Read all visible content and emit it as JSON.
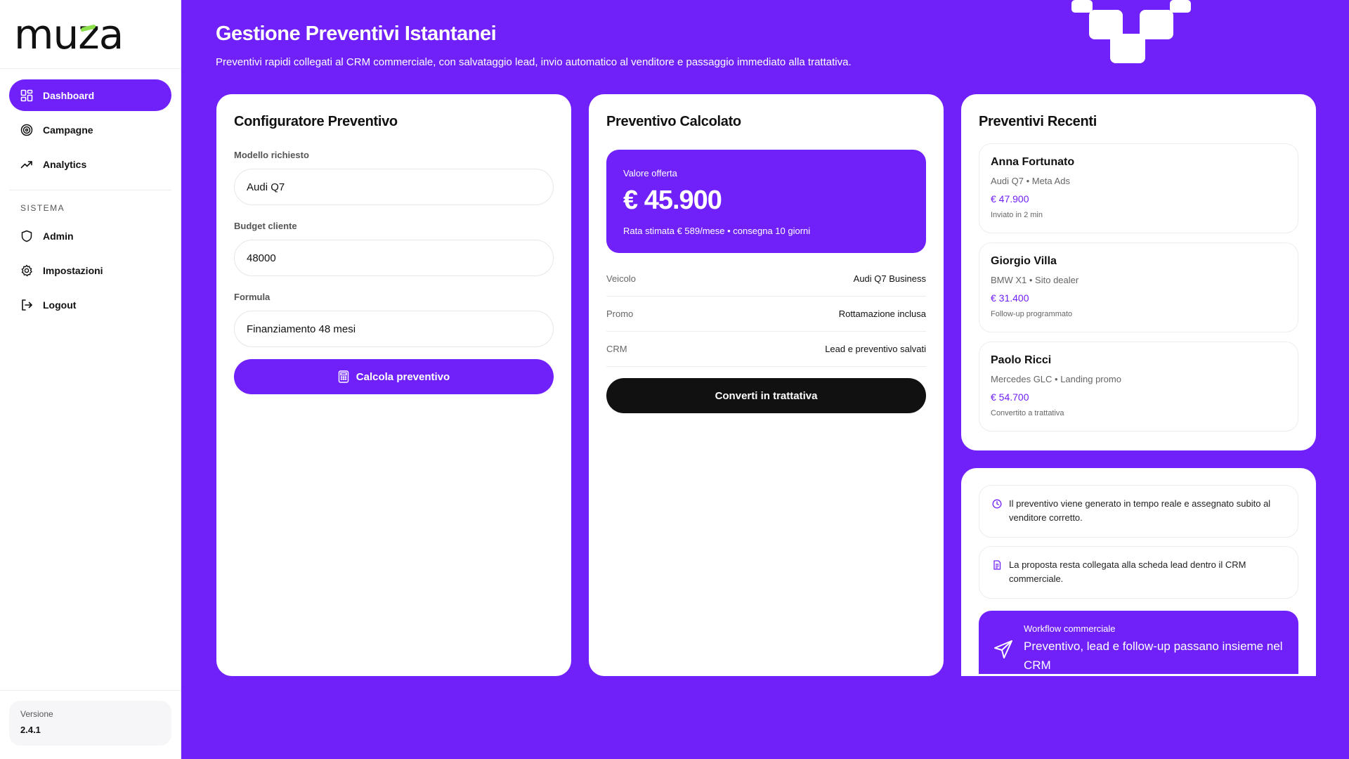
{
  "brand": {
    "logo_text_left": "mu",
    "logo_text_z": "z",
    "logo_text_right": "a"
  },
  "sidebar": {
    "items": [
      {
        "label": "Dashboard",
        "icon": "dashboard-icon",
        "active": true
      },
      {
        "label": "Campagne",
        "icon": "target-icon"
      },
      {
        "label": "Analytics",
        "icon": "trend-up-icon"
      }
    ],
    "section_label": "SISTEMA",
    "system_items": [
      {
        "label": "Admin",
        "icon": "shield-icon"
      },
      {
        "label": "Impostazioni",
        "icon": "gear-icon"
      },
      {
        "label": "Logout",
        "icon": "logout-icon"
      }
    ],
    "version_label": "Versione",
    "version_value": "2.4.1"
  },
  "header": {
    "title": "Gestione Preventivi Istantanei",
    "subtitle": "Preventivi rapidi collegati al CRM commerciale, con salvataggio lead, invio automatico al venditore e passaggio immediato alla trattativa."
  },
  "configurator": {
    "title": "Configuratore Preventivo",
    "model_label": "Modello richiesto",
    "model_value": "Audi Q7",
    "budget_label": "Budget cliente",
    "budget_value": "48000",
    "formula_label": "Formula",
    "formula_value": "Finanziamento 48 mesi",
    "calc_button": "Calcola preventivo"
  },
  "calculated": {
    "title": "Preventivo Calcolato",
    "offer_label": "Valore offerta",
    "offer_value": "€ 45.900",
    "offer_rate": "Rata stimata € 589/mese • consegna 10 giorni",
    "rows": [
      {
        "key": "Veicolo",
        "value": "Audi Q7 Business"
      },
      {
        "key": "Promo",
        "value": "Rottamazione inclusa"
      },
      {
        "key": "CRM",
        "value": "Lead e preventivo salvati"
      }
    ],
    "convert_button": "Converti in trattativa"
  },
  "recent": {
    "title": "Preventivi Recenti",
    "quotes": [
      {
        "name": "Anna Fortunato",
        "model": "Audi Q7 • Meta Ads",
        "price": "€ 47.900",
        "status": "Inviato in 2 min"
      },
      {
        "name": "Giorgio Villa",
        "model": "BMW X1 • Sito dealer",
        "price": "€ 31.400",
        "status": "Follow-up programmato"
      },
      {
        "name": "Paolo Ricci",
        "model": "Mercedes GLC • Landing promo",
        "price": "€ 54.700",
        "status": "Convertito a trattativa"
      }
    ]
  },
  "info": {
    "notes": [
      {
        "icon": "clock-icon",
        "text": "Il preventivo viene generato in tempo reale e assegnato subito al venditore corretto."
      },
      {
        "icon": "document-icon",
        "text": "La proposta resta collegata alla scheda lead dentro il CRM commerciale."
      }
    ],
    "workflow_label": "Workflow commerciale",
    "workflow_text": "Preventivo, lead e follow-up passano insieme nel CRM"
  },
  "colors": {
    "accent": "#7020F8",
    "brand_green": "#8BE04B",
    "dark": "#111111"
  }
}
